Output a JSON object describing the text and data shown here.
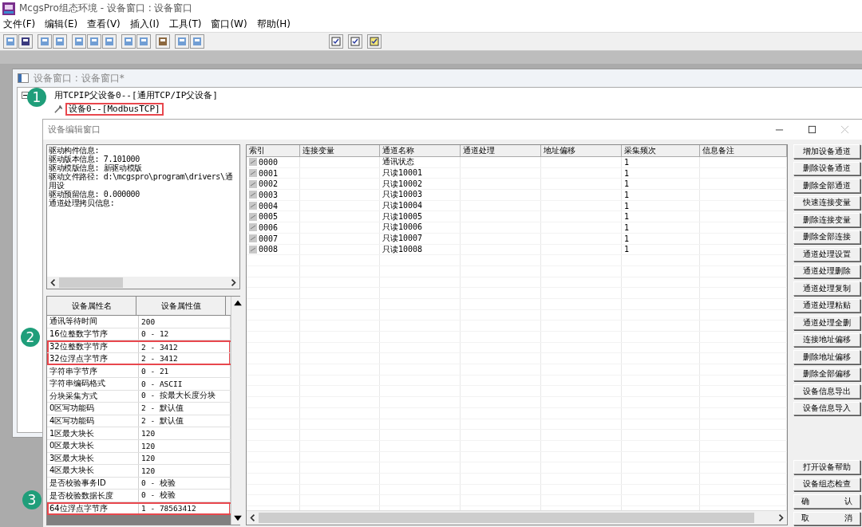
{
  "app": {
    "title": "McgsPro组态环境 - 设备窗口 : 设备窗口"
  },
  "menu": [
    "文件(F)",
    "编辑(E)",
    "查看(V)",
    "插入(I)",
    "工具(T)",
    "窗口(W)",
    "帮助(H)"
  ],
  "device_window": {
    "title": "设备窗口 : 设备窗口*",
    "tree": [
      {
        "label": "用TCPIP父设备0--[通用TCP/IP父设备]",
        "expanded": true,
        "children": [
          {
            "label": "设备0--[ModbusTCP]",
            "highlighted": true
          }
        ]
      }
    ]
  },
  "dialog": {
    "title": "设备编辑窗口",
    "driver_info": [
      "驱动构件信息:",
      "驱动版本信息: 7.101000",
      "驱动模版信息: 新驱动模版",
      "驱动文件路径: d:\\mcgspro\\program\\drivers\\通用设",
      "驱动预留信息: 0.000000",
      "通道处理拷贝信息:"
    ],
    "property_table": {
      "columns": [
        "设备属性名",
        "设备属性值"
      ],
      "rows": [
        {
          "name": "通讯等待时间",
          "value": "200",
          "highlighted": false
        },
        {
          "name": "16位整数字节序",
          "value": "0 - 12",
          "highlighted": false
        },
        {
          "name": "32位整数字节序",
          "value": "2 - 3412",
          "highlighted": true
        },
        {
          "name": "32位浮点字节序",
          "value": "2 - 3412",
          "highlighted": true
        },
        {
          "name": "字符串字节序",
          "value": "0 - 21",
          "highlighted": false
        },
        {
          "name": "字符串编码格式",
          "value": "0 - ASCII",
          "highlighted": false
        },
        {
          "name": "分块采集方式",
          "value": "0 - 按最大长度分块",
          "highlighted": false
        },
        {
          "name": "0区写功能码",
          "value": "2 - 默认值",
          "highlighted": false
        },
        {
          "name": "4区写功能码",
          "value": "2 - 默认值",
          "highlighted": false
        },
        {
          "name": "1区最大块长",
          "value": "120",
          "highlighted": false
        },
        {
          "name": "0区最大块长",
          "value": "120",
          "highlighted": false
        },
        {
          "name": "3区最大块长",
          "value": "120",
          "highlighted": false
        },
        {
          "name": "4区最大块长",
          "value": "120",
          "highlighted": false
        },
        {
          "name": "是否校验事务ID",
          "value": "0 - 校验",
          "highlighted": false
        },
        {
          "name": "是否校验数据长度",
          "value": "0 - 校验",
          "highlighted": false
        },
        {
          "name": "64位浮点字节序",
          "value": "1 - 78563412",
          "highlighted": true
        }
      ]
    },
    "channel_table": {
      "columns": [
        "索引",
        "连接变量",
        "通道名称",
        "通道处理",
        "地址偏移",
        "采集频次",
        "信息备注"
      ],
      "rows": [
        [
          "0000",
          "",
          "通讯状态",
          "",
          "",
          "1",
          ""
        ],
        [
          "0001",
          "",
          "只读10001",
          "",
          "",
          "1",
          ""
        ],
        [
          "0002",
          "",
          "只读10002",
          "",
          "",
          "1",
          ""
        ],
        [
          "0003",
          "",
          "只读10003",
          "",
          "",
          "1",
          ""
        ],
        [
          "0004",
          "",
          "只读10004",
          "",
          "",
          "1",
          ""
        ],
        [
          "0005",
          "",
          "只读10005",
          "",
          "",
          "1",
          ""
        ],
        [
          "0006",
          "",
          "只读10006",
          "",
          "",
          "1",
          ""
        ],
        [
          "0007",
          "",
          "只读10007",
          "",
          "",
          "1",
          ""
        ],
        [
          "0008",
          "",
          "只读10008",
          "",
          "",
          "1",
          ""
        ]
      ]
    },
    "buttons": [
      "增加设备通道",
      "删除设备通道",
      "删除全部通道",
      "快速连接变量",
      "删除连接变量",
      "删除全部连接",
      "通道处理设置",
      "通道处理删除",
      "通道处理复制",
      "通道处理粘贴",
      "通道处理全删",
      "连接地址偏移",
      "删除地址偏移",
      "删除全部偏移",
      "设备信息导出",
      "设备信息导入"
    ],
    "bottom_buttons": [
      "打开设备帮助",
      "设备组态检查",
      "确 认",
      "取 消"
    ]
  },
  "callouts": [
    "1",
    "2",
    "3"
  ]
}
